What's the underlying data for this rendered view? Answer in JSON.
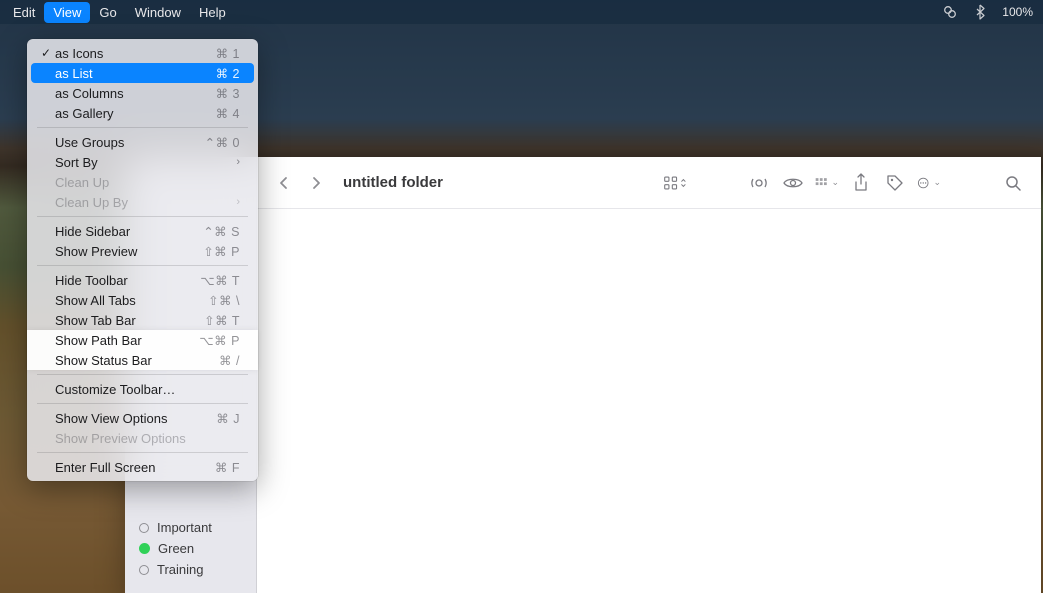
{
  "menubar": {
    "items": [
      "Edit",
      "View",
      "Go",
      "Window",
      "Help"
    ],
    "active_index": 1,
    "battery": "100%"
  },
  "finder": {
    "title": "untitled folder",
    "sidebar_tags": [
      {
        "label": "Important",
        "color": "outline"
      },
      {
        "label": "Green",
        "color": "green"
      },
      {
        "label": "Training",
        "color": "outline"
      }
    ]
  },
  "view_menu": {
    "groups": [
      [
        {
          "label": "as Icons",
          "shortcut": "⌘ 1",
          "checked": true
        },
        {
          "label": "as List",
          "shortcut": "⌘ 2",
          "highlight": true
        },
        {
          "label": "as Columns",
          "shortcut": "⌘ 3"
        },
        {
          "label": "as Gallery",
          "shortcut": "⌘ 4"
        }
      ],
      [
        {
          "label": "Use Groups",
          "shortcut": "⌃⌘ 0"
        },
        {
          "label": "Sort By",
          "submenu": true
        },
        {
          "label": "Clean Up",
          "disabled": true
        },
        {
          "label": "Clean Up By",
          "disabled": true,
          "submenu": true
        }
      ],
      [
        {
          "label": "Hide Sidebar",
          "shortcut": "⌃⌘ S"
        },
        {
          "label": "Show Preview",
          "shortcut": "⇧⌘ P"
        }
      ],
      [
        {
          "label": "Hide Toolbar",
          "shortcut": "⌥⌘ T"
        },
        {
          "label": "Show All Tabs",
          "shortcut": "⇧⌘ \\"
        },
        {
          "label": "Show Tab Bar",
          "shortcut": "⇧⌘ T"
        },
        {
          "label": "Show Path Bar",
          "shortcut": "⌥⌘ P",
          "section_highlight": true
        },
        {
          "label": "Show Status Bar",
          "shortcut": "⌘ /",
          "section_highlight": true
        }
      ],
      [
        {
          "label": "Customize Toolbar…"
        }
      ],
      [
        {
          "label": "Show View Options",
          "shortcut": "⌘ J"
        },
        {
          "label": "Show Preview Options",
          "disabled": true
        }
      ],
      [
        {
          "label": "Enter Full Screen",
          "shortcut": "⌘ F"
        }
      ]
    ]
  }
}
